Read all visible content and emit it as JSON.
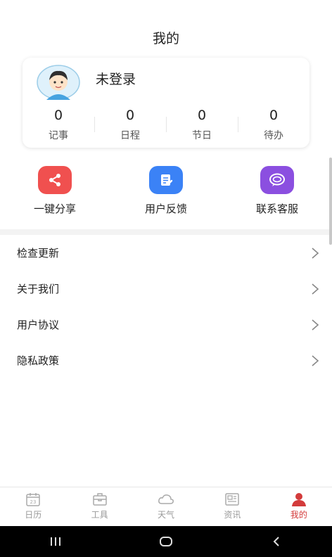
{
  "header": {
    "title": "我的"
  },
  "profile": {
    "username": "未登录",
    "stats": [
      {
        "value": "0",
        "label": "记事"
      },
      {
        "value": "0",
        "label": "日程"
      },
      {
        "value": "0",
        "label": "节日"
      },
      {
        "value": "0",
        "label": "待办"
      }
    ]
  },
  "actions": [
    {
      "label": "一键分享",
      "icon": "share-icon",
      "color": "#f0504f"
    },
    {
      "label": "用户反馈",
      "icon": "feedback-icon",
      "color": "#3b82f6"
    },
    {
      "label": "联系客服",
      "icon": "chat-icon",
      "color": "#8b4fe0"
    }
  ],
  "menu": {
    "items": [
      {
        "label": "检查更新"
      },
      {
        "label": "关于我们"
      },
      {
        "label": "用户协议"
      },
      {
        "label": "隐私政策"
      }
    ]
  },
  "tabbar": {
    "tabs": [
      {
        "label": "日历",
        "icon": "calendar-icon",
        "icon_text": "23"
      },
      {
        "label": "工具",
        "icon": "toolbox-icon"
      },
      {
        "label": "天气",
        "icon": "cloud-icon"
      },
      {
        "label": "资讯",
        "icon": "news-icon"
      },
      {
        "label": "我的",
        "icon": "user-icon",
        "active": true
      }
    ],
    "active_color": "#d33b3b",
    "inactive_color": "#999999"
  }
}
